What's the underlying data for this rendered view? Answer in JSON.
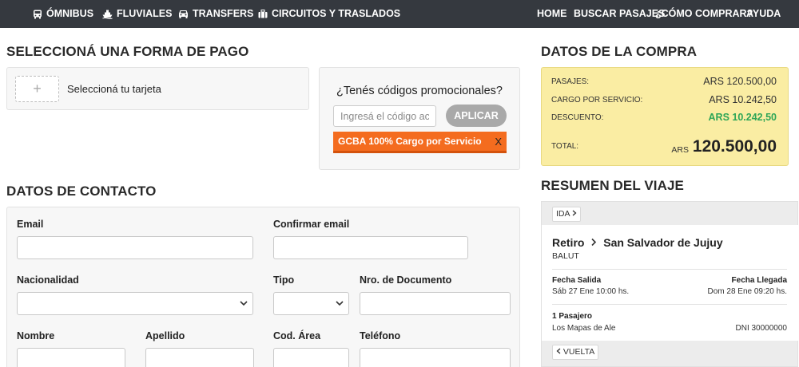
{
  "nav": {
    "left": [
      {
        "label": "ÓMNIBUS",
        "icon": "bus-icon"
      },
      {
        "label": "FLUVIALES",
        "icon": "ship-icon"
      },
      {
        "label": "TRANSFERS",
        "icon": "car-icon"
      },
      {
        "label": "CIRCUITOS Y TRASLADOS",
        "icon": "suitcase-icon"
      }
    ],
    "right": [
      "HOME",
      "BUSCAR PASAJES",
      "¿CÓMO COMPRAR?",
      "AYUDA"
    ]
  },
  "payment": {
    "title": "SELECCIONÁ UNA FORMA DE PAGO",
    "add_symbol": "+",
    "card_label": "Seleccioná tu tarjeta"
  },
  "promo": {
    "title": "¿Tenés códigos promocionales?",
    "placeholder": "Ingresá el código acá",
    "apply_label": "APLICAR",
    "applied_code": "GCBA 100% Cargo por Servicio",
    "remove_label": "X"
  },
  "contact": {
    "title": "DATOS DE CONTACTO",
    "email_label": "Email",
    "confirm_email_label": "Confirmar email",
    "nationality_label": "Nacionalidad",
    "doc_type_label": "Tipo",
    "doc_number_label": "Nro. de Documento",
    "first_name_label": "Nombre",
    "last_name_label": "Apellido",
    "area_code_label": "Cod. Área",
    "phone_label": "Teléfono"
  },
  "purchase": {
    "title": "DATOS DE LA COMPRA",
    "rows": [
      {
        "label": "PASAJES:",
        "value": "ARS 120.500,00"
      },
      {
        "label": "CARGO POR SERVICIO:",
        "value": "ARS 10.242,50"
      },
      {
        "label": "DESCUENTO:",
        "value": "ARS 10.242,50"
      }
    ],
    "total_label": "TOTAL:",
    "total_currency": "ARS",
    "total_value": "120.500,00",
    "discount_color": "#2ea657",
    "panel_color": "#faeda3"
  },
  "trip": {
    "title": "RESUMEN DEL VIAJE",
    "ida_label": "IDA",
    "origin": "Retiro",
    "destination": "San Salvador de Jujuy",
    "company": "BALUT",
    "departure_label": "Fecha Salida",
    "departure_value": "Sáb 27 Ene 10:00 hs.",
    "arrival_label": "Fecha Llegada",
    "arrival_value": "Dom 28 Ene 09:20 hs.",
    "passengers_label": "1 Pasajero",
    "passenger_name": "Los Mapas de Ale",
    "passenger_doc": "DNI 30000000",
    "vuelta_label": "VUELTA"
  },
  "colors": {
    "nav_bg": "#35393f",
    "promo_tag": "#f46c1f",
    "apply_button": "#a9a9a9"
  }
}
